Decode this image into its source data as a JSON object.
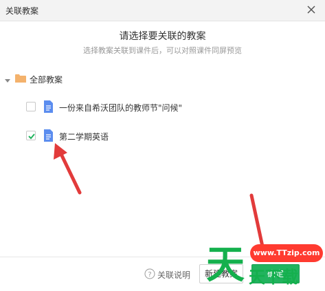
{
  "window": {
    "title": "关联教案"
  },
  "dialog": {
    "heading": "请选择要关联的教案",
    "subheading": "选择教案关联到课件后，可以对照课件同屏预览"
  },
  "tree": {
    "root_label": "全部教案",
    "items": [
      {
        "label": "一份来自希沃团队的教师节\"问候\"",
        "checked": false
      },
      {
        "label": "第二学期英语",
        "checked": true
      }
    ]
  },
  "footer": {
    "help_label": "关联说明",
    "new_button": "新建教案",
    "ok_button": "确定"
  },
  "watermark": {
    "site": "www.TTzip.com",
    "big_char": "天",
    "chars": "天下载"
  },
  "colors": {
    "accent": "#22b35e",
    "check": "#22b35e",
    "folder": "#f4b26c",
    "doc": "#5b8def",
    "annotation_arrow": "#e23b3b"
  },
  "icons": [
    "close-icon",
    "caret-down-icon",
    "folder-icon",
    "document-icon",
    "checkbox-icon",
    "help-circle-icon"
  ]
}
